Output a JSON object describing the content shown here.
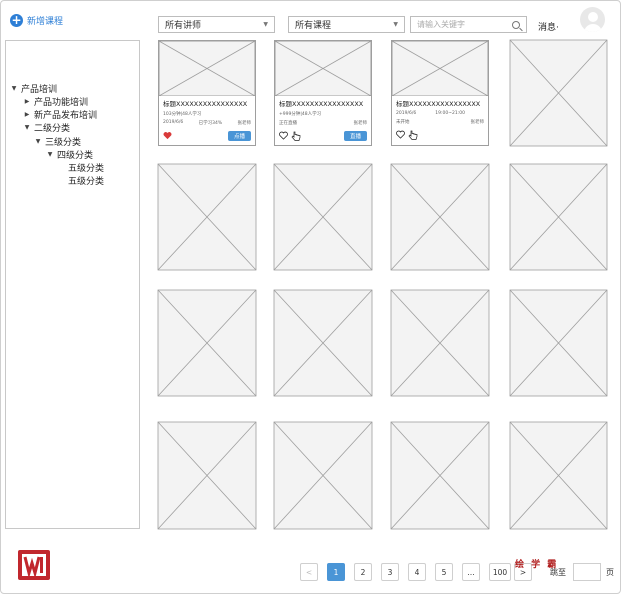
{
  "toolbar": {
    "add_course": "新增课程",
    "teacher_select": "所有讲师",
    "course_select": "所有课程",
    "search_placeholder": "请输入关键字",
    "messages": "消息·"
  },
  "tree": [
    "产品培训",
    "产品功能培训",
    "新产品发布培训",
    "二级分类",
    "三级分类",
    "四级分类",
    "五级分类",
    "五级分类"
  ],
  "cards": [
    {
      "title": "标题XXXXXXXXXXXXXXXX",
      "meta": "103分钟|48人学习",
      "date": "2019/6/6",
      "status": "已学习34%",
      "teacher": "张老师",
      "badge": "点播"
    },
    {
      "title": "标题XXXXXXXXXXXXXXXX",
      "meta": "+999分钟|48人学习",
      "date": "",
      "status": "正在直播",
      "teacher": "张老师",
      "badge": "直播"
    },
    {
      "title": "标题XXXXXXXXXXXXXXXX",
      "meta": "",
      "date": "2019/6/6",
      "status": "19:00~21:00",
      "teacher": "",
      "badge": "",
      "sub": "未开始",
      "sub_teacher": "张老师"
    }
  ],
  "pagination": {
    "prev": "<",
    "pages": [
      "1",
      "2",
      "3",
      "4",
      "5",
      "…",
      "100"
    ],
    "next": ">",
    "jump_label": "跳至",
    "unit": "页"
  },
  "watermark": "绘学霸",
  "colors": {
    "accent": "#4a95d6",
    "brand": "#c1272d",
    "heart": "#d93a3a"
  }
}
